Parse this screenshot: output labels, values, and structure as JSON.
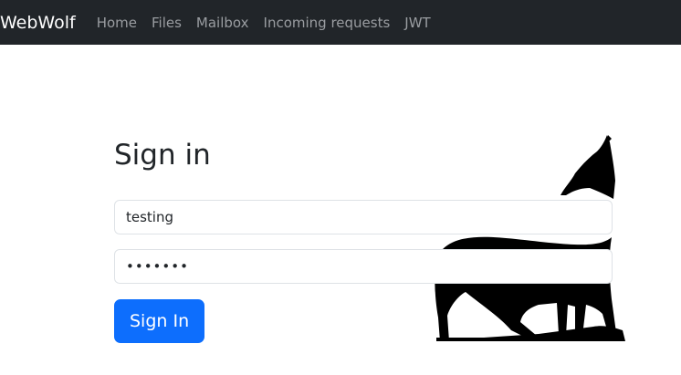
{
  "navbar": {
    "brand": "WebWolf",
    "links": [
      "Home",
      "Files",
      "Mailbox",
      "Incoming requests",
      "JWT"
    ]
  },
  "login": {
    "title": "Sign in",
    "username_value": "testing",
    "password_value": "•••••••",
    "submit_label": "Sign In"
  },
  "colors": {
    "navbar_bg": "#212529",
    "primary": "#0d6efd"
  }
}
